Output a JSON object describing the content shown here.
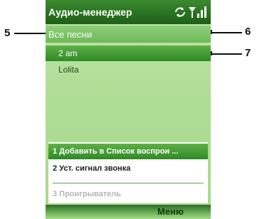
{
  "window": {
    "title": "Аудио-менеджер"
  },
  "filter": {
    "label": "Все песни"
  },
  "songs": [
    {
      "label": "2 am"
    },
    {
      "label": "Lolita"
    }
  ],
  "menu": {
    "items": [
      {
        "label": "1 Добавить в Список воспрои ...",
        "state": "highlighted"
      },
      {
        "label": "2 Уст. сигнал звонка",
        "state": "normal"
      },
      {
        "label": "3 Проигрыватель",
        "state": "disabled"
      }
    ]
  },
  "softkeys": {
    "right": "Меню"
  },
  "callouts": [
    "5",
    "6",
    "7"
  ],
  "colors": {
    "titlebar": "#1e5f17",
    "highlight": "#2f8a23",
    "background": "#aedd95"
  },
  "icons": [
    "sync-icon",
    "signal-strength-icon"
  ]
}
